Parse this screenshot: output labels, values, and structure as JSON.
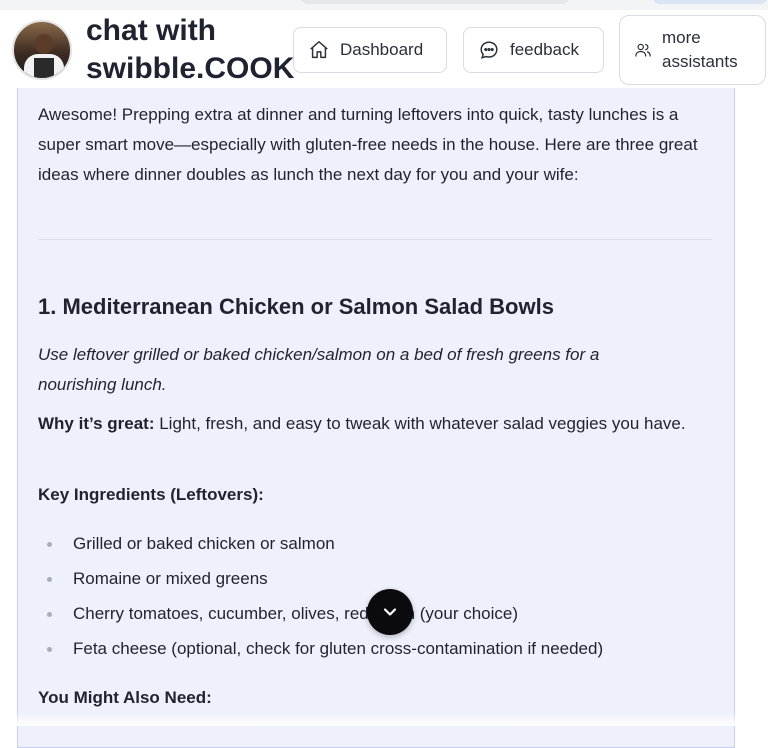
{
  "header": {
    "title": "chat with swibble.COOK",
    "buttons": {
      "dashboard": "Dashboard",
      "feedback": "feedback",
      "more_assistants": "more assistants"
    }
  },
  "message": {
    "intro": "Awesome! Prepping extra at dinner and turning leftovers into quick, tasty lunches is a super smart move—especially with gluten-free needs in the house. Here are three great ideas where dinner doubles as lunch the next day for you and your wife:",
    "section_title": "1. Mediterranean Chicken or Salmon Salad Bowls",
    "section_subtitle": "Use leftover grilled or baked chicken/salmon on a bed of fresh greens for a nourishing lunch.",
    "why_label": "Why it’s great:",
    "why_text": " Light, fresh, and easy to tweak with whatever salad veggies you have.",
    "key_ingredients_heading": "Key Ingredients (Leftovers):",
    "ingredients": [
      "Grilled or baked chicken or salmon",
      "Romaine or mixed greens",
      "Cherry tomatoes, cucumber, olives, red onion (your choice)",
      "Feta cheese (optional, check for gluten cross-contamination if needed)"
    ],
    "also_need_heading": "You Might Also Need:"
  },
  "icons": {
    "dashboard": "home-icon",
    "feedback": "chat-bubble-icon",
    "more_assistants": "users-icon",
    "scroll": "chevron-down-icon"
  },
  "colors": {
    "chat_background": "#eef0fb",
    "chat_border": "#c7cdf3",
    "scroll_button": "#0b0b0f"
  }
}
